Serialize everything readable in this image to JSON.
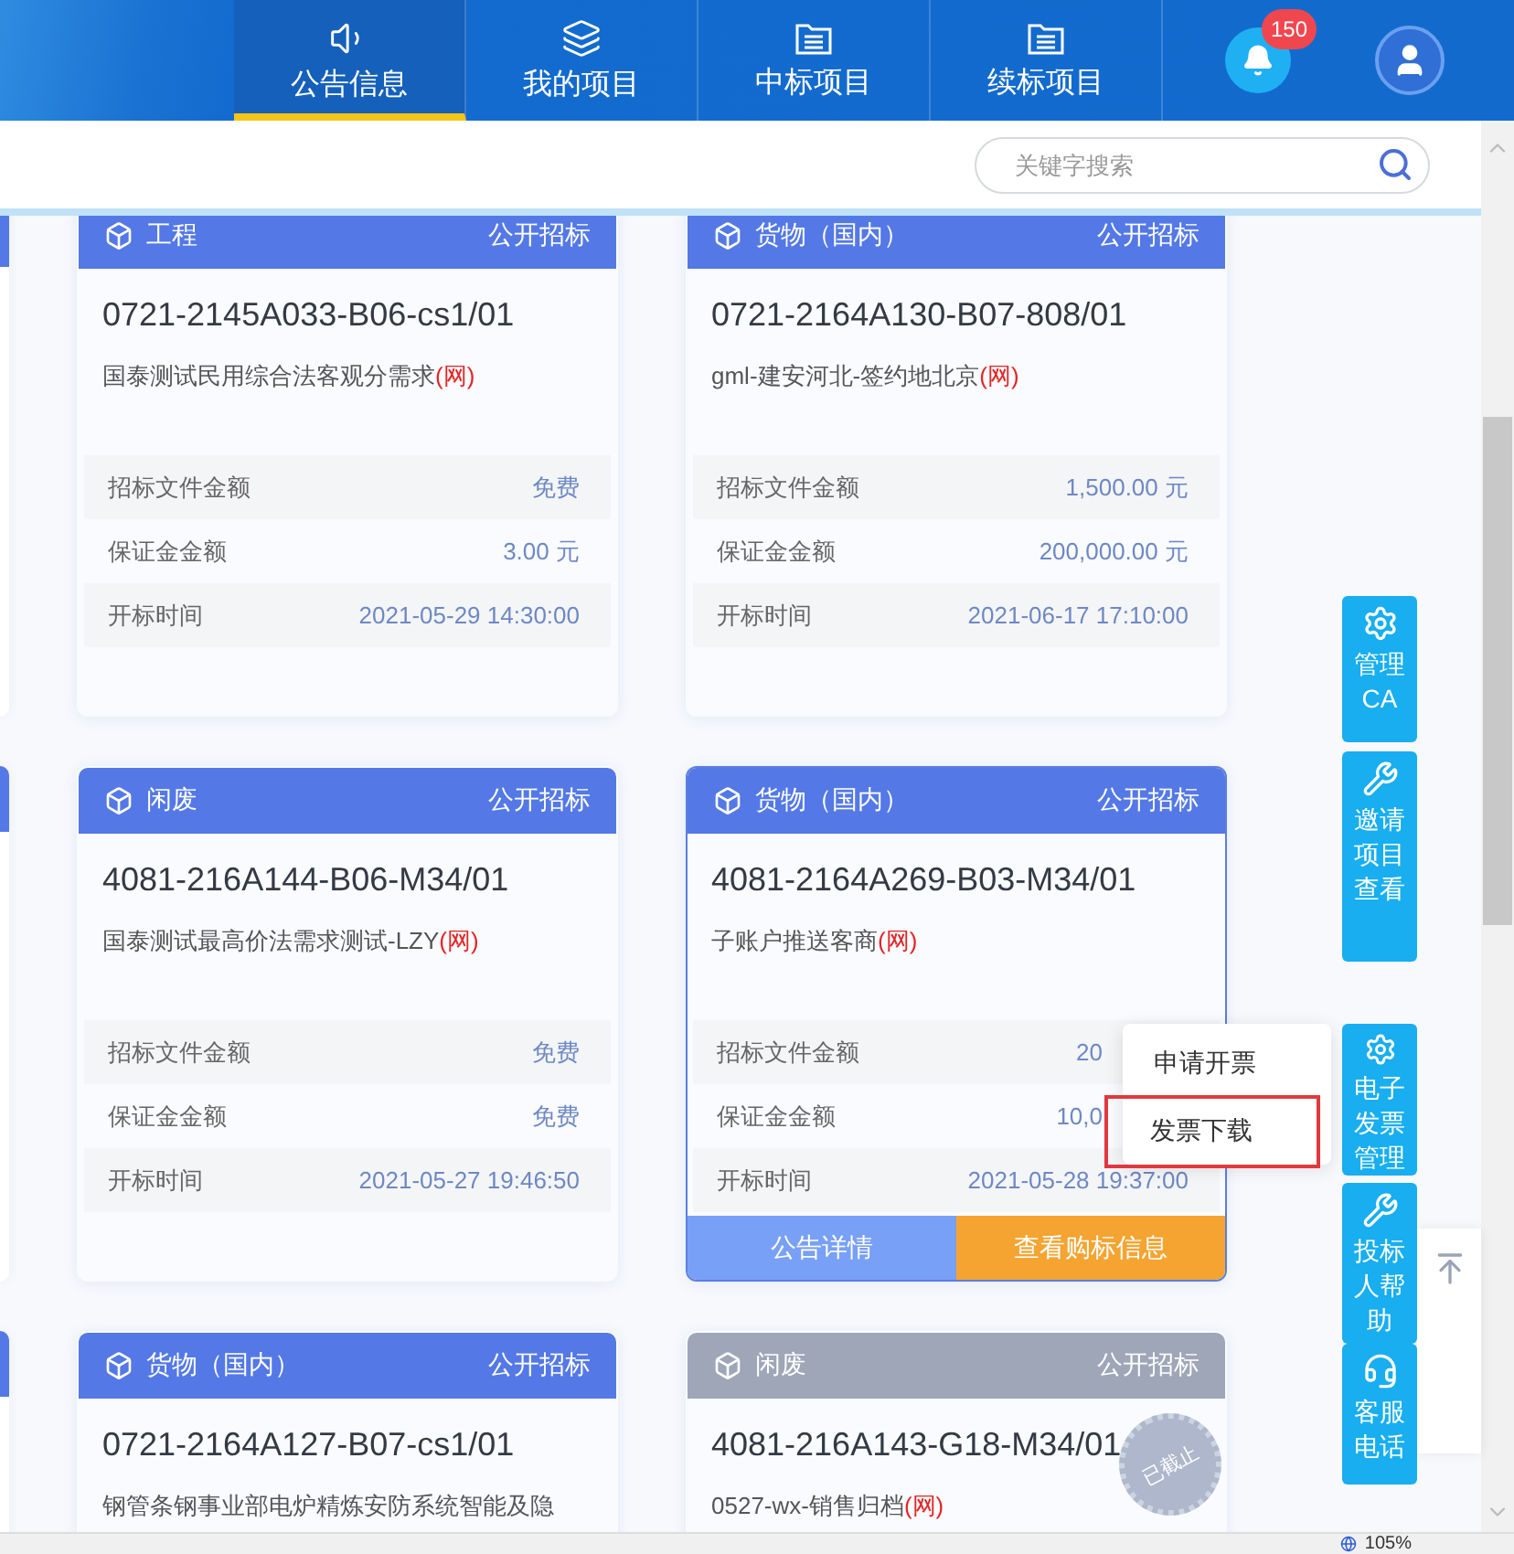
{
  "nav": {
    "tabs": [
      {
        "kind": "speaker",
        "label": "公告信息",
        "selected": true
      },
      {
        "kind": "layers",
        "label": "我的项目",
        "selected": false
      },
      {
        "kind": "folder",
        "label": "中标项目",
        "selected": false
      },
      {
        "kind": "folder",
        "label": "续标项目",
        "selected": false
      }
    ],
    "notifications": {
      "count": "150"
    }
  },
  "search": {
    "placeholder": "关键字搜索"
  },
  "cards": [
    {
      "category": "工程",
      "method": "公开招标",
      "color": "#5479e6",
      "highlighted": false,
      "code": "0721-2145A033-B06-cs1/01",
      "title": "国泰测试民用综合法客观分需求",
      "channel": "(网)",
      "fields": [
        {
          "label": "招标文件金额",
          "value": "免费"
        },
        {
          "label": "保证金金额",
          "value": "3.00 元"
        },
        {
          "label": "开标时间",
          "value": "2021-05-29 14:30:00"
        }
      ]
    },
    {
      "category": "货物（国内）",
      "method": "公开招标",
      "color": "#5479e6",
      "highlighted": false,
      "code": "0721-2164A130-B07-808/01",
      "title": "gml-建安河北-签约地北京",
      "channel": "(网)",
      "fields": [
        {
          "label": "招标文件金额",
          "value": "1,500.00 元"
        },
        {
          "label": "保证金金额",
          "value": "200,000.00 元"
        },
        {
          "label": "开标时间",
          "value": "2021-06-17 17:10:00"
        }
      ]
    },
    {
      "category": "闲废",
      "method": "公开招标",
      "color": "#5479e6",
      "highlighted": false,
      "code": "4081-216A144-B06-M34/01",
      "title": "国泰测试最高价法需求测试-LZY",
      "channel": "(网)",
      "fields": [
        {
          "label": "招标文件金额",
          "value": "免费"
        },
        {
          "label": "保证金金额",
          "value": "免费"
        },
        {
          "label": "开标时间",
          "value": "2021-05-27 19:46:50"
        }
      ]
    },
    {
      "category": "货物（国内）",
      "method": "公开招标",
      "color": "#5479e6",
      "highlighted": true,
      "code": "4081-2164A269-B03-M34/01",
      "title": "子账户推送客商",
      "channel": "(网)",
      "fields": [
        {
          "label": "招标文件金额",
          "value": "20"
        },
        {
          "label": "保证金金额",
          "value": "10,0"
        },
        {
          "label": "开标时间",
          "value": "2021-05-28 19:37:00"
        }
      ],
      "actions": [
        {
          "kind": "primary",
          "label": "公告详情"
        },
        {
          "kind": "warning",
          "label": "查看购标信息"
        }
      ],
      "menu": [
        {
          "label": "申请开票",
          "selected": false
        },
        {
          "label": "发票下载",
          "selected": true
        }
      ]
    },
    {
      "category": "货物（国内）",
      "method": "公开招标",
      "color": "#5479e6",
      "highlighted": false,
      "code": "0721-2164A127-B07-cs1/01",
      "title": "钢管条钢事业部电炉精炼安防系统智能及隐"
    },
    {
      "category": "闲废",
      "method": "公开招标",
      "color": "#9ea6b8",
      "highlighted": false,
      "code": "4081-216A143-G18-M34/01",
      "title": "0527-wx-销售归档",
      "channel": "(网)",
      "stamp": "已截止"
    }
  ],
  "side_buttons": [
    {
      "kind": "gear",
      "label": "管理CA"
    },
    {
      "kind": "wrench",
      "label": "邀请项目查看"
    },
    {
      "kind": "gear",
      "label": "电子发票管理"
    },
    {
      "kind": "wrench",
      "label": "投标人帮助"
    },
    {
      "kind": "headset",
      "label": "客服电话"
    }
  ],
  "status_bar": {
    "zoom": "105%"
  }
}
